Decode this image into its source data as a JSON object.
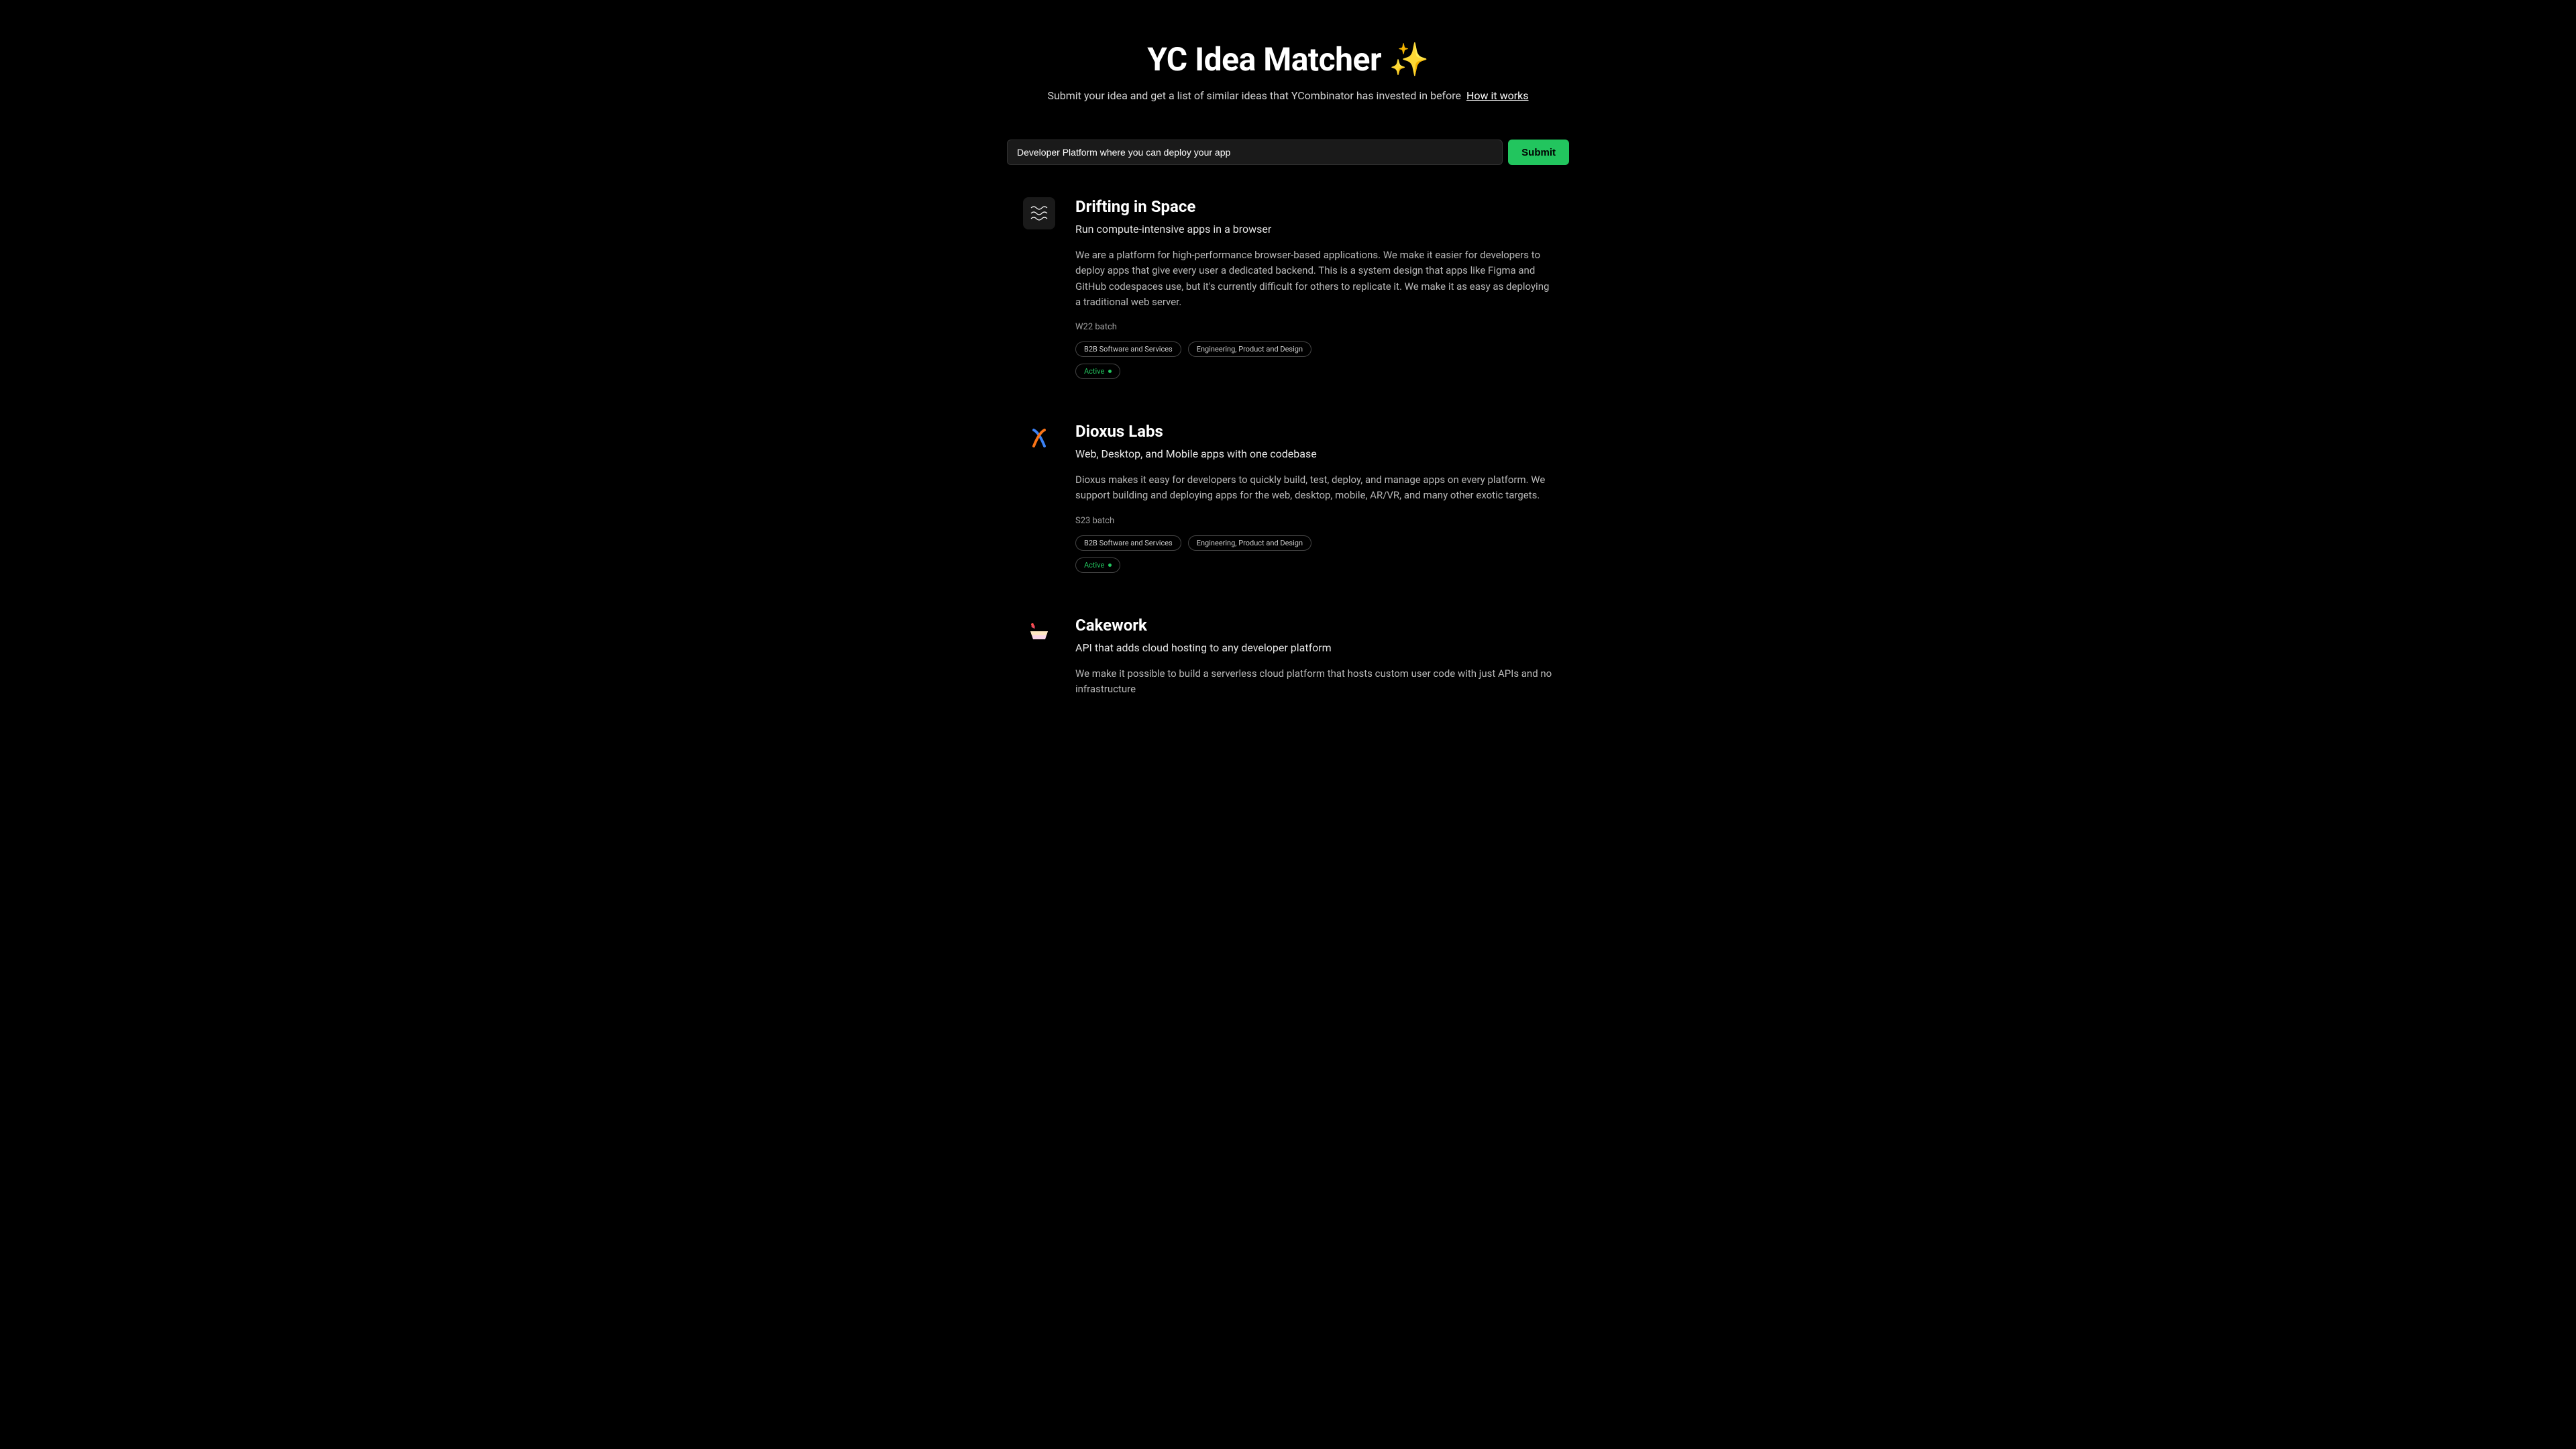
{
  "header": {
    "title": "YC Idea Matcher ✨",
    "subtitle": "Submit your idea and get a list of similar ideas that YCombinator has invested in before",
    "how_link": "How it works"
  },
  "search": {
    "value": "Developer Platform where you can deploy your app",
    "submit_label": "Submit"
  },
  "results": [
    {
      "name": "Drifting in Space",
      "tagline": "Run compute-intensive apps in a browser",
      "description": "We are a platform for high-performance browser-based applications. We make it easier for developers to deploy apps that give every user a dedicated backend. This is a system design that apps like Figma and GitHub codespaces use, but it's currently difficult for others to replicate it. We make it as easy as deploying a traditional web server.",
      "batch": "W22 batch",
      "tags": [
        "B2B Software and Services",
        "Engineering, Product and Design"
      ],
      "status": "Active"
    },
    {
      "name": "Dioxus Labs",
      "tagline": "Web, Desktop, and Mobile apps with one codebase",
      "description": "Dioxus makes it easy for developers to quickly build, test, deploy, and manage apps on every platform. We support building and deploying apps for the web, desktop, mobile, AR/VR, and many other exotic targets.",
      "batch": "S23 batch",
      "tags": [
        "B2B Software and Services",
        "Engineering, Product and Design"
      ],
      "status": "Active"
    },
    {
      "name": "Cakework",
      "tagline": "API that adds cloud hosting to any developer platform",
      "description": "We make it possible to build a serverless cloud platform that hosts custom user code with just APIs and no infrastructure",
      "batch": "",
      "tags": [],
      "status": ""
    }
  ]
}
